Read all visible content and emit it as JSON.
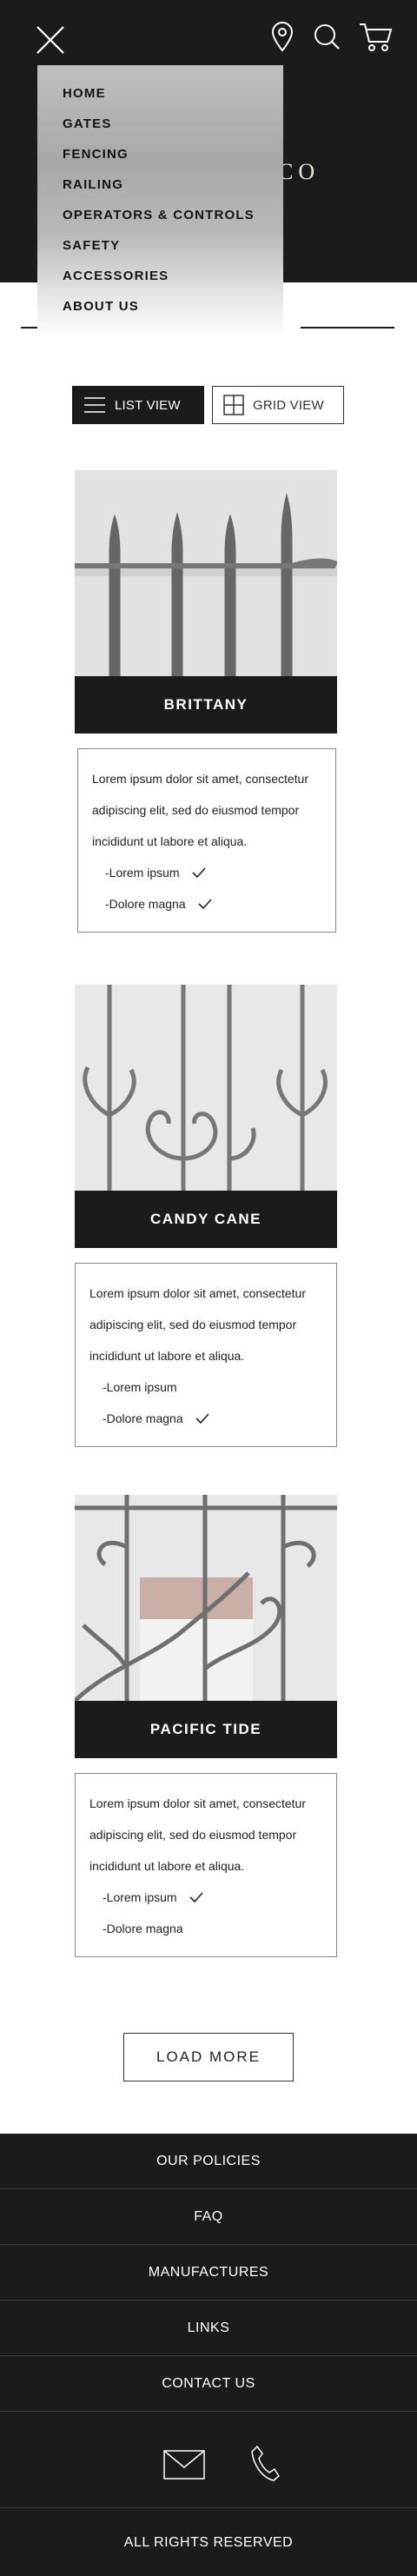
{
  "header": {
    "brand_peek": "CO",
    "icons": [
      "close-icon",
      "location-pin-icon",
      "search-icon",
      "cart-icon"
    ]
  },
  "nav": {
    "items": [
      {
        "label": "HOME"
      },
      {
        "label": "GATES"
      },
      {
        "label": "FENCING"
      },
      {
        "label": "RAILING"
      },
      {
        "label": "OPERATORS & CONTROLS"
      },
      {
        "label": "SAFETY"
      },
      {
        "label": "ACCESSORIES"
      },
      {
        "label": "ABOUT US"
      }
    ]
  },
  "view_toggle": {
    "list_label": "LIST VIEW",
    "grid_label": "GRID VIEW",
    "active": "list"
  },
  "products": [
    {
      "name": "BRITTANY",
      "desc_lines": [
        "Lorem ipsum dolor sit amet, consectetur",
        "adipiscing elit, sed do eiusmod tempor",
        "incididunt ut labore et aliqua."
      ],
      "features": [
        {
          "label": "-Lorem ipsum",
          "checked": true
        },
        {
          "label": "-Dolore magna",
          "checked": true
        }
      ]
    },
    {
      "name": "CANDY CANE",
      "desc_lines": [
        "Lorem ipsum dolor sit amet, consectetur",
        "adipiscing elit, sed do eiusmod tempor",
        "incididunt ut labore et aliqua."
      ],
      "features": [
        {
          "label": "-Lorem ipsum",
          "checked": false
        },
        {
          "label": "-Dolore magna",
          "checked": true
        }
      ]
    },
    {
      "name": "PACIFIC TIDE",
      "desc_lines": [
        "Lorem ipsum dolor sit amet, consectetur",
        "adipiscing elit, sed do eiusmod tempor",
        "incididunt ut labore et aliqua."
      ],
      "features": [
        {
          "label": "-Lorem ipsum",
          "checked": true
        },
        {
          "label": "-Dolore magna",
          "checked": false
        }
      ]
    }
  ],
  "load_more_label": "LOAD MORE",
  "footer": {
    "links": [
      {
        "label": "OUR POLICIES"
      },
      {
        "label": "FAQ"
      },
      {
        "label": "MANUFACTURES"
      },
      {
        "label": "LINKS"
      },
      {
        "label": "CONTACT US"
      }
    ],
    "icons": [
      "mail-icon",
      "phone-icon"
    ],
    "copyright": "ALL RIGHTS RESERVED"
  },
  "colors": {
    "dark": "#1b1b1b",
    "light": "#ffffff",
    "menu_gray": "#a8a8a8"
  }
}
